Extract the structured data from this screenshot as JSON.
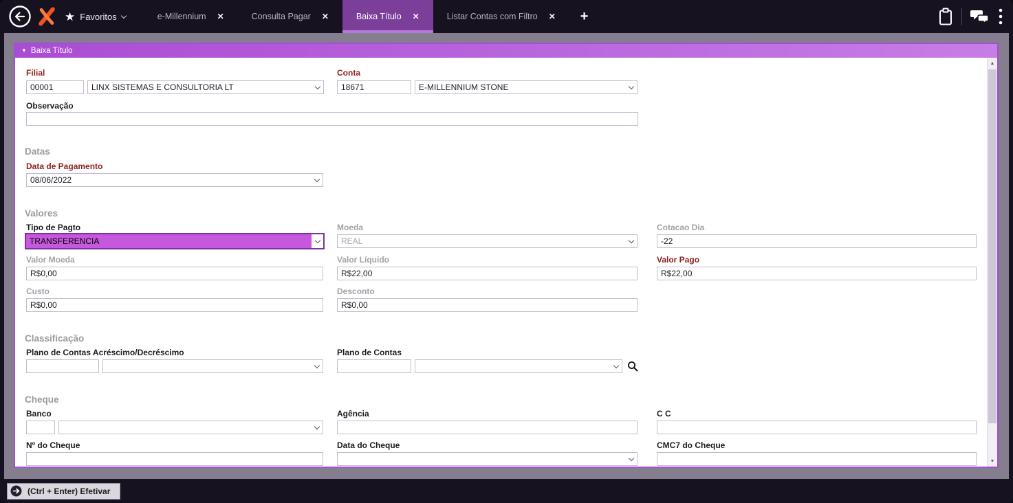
{
  "colors": {
    "topbar_bg": "#171220",
    "workspace_bg": "#847e8f",
    "panel_border": "#a24fd0",
    "panel_header_start": "#aa4cd4",
    "panel_header_end": "#c77de6",
    "active_tab_bg": "#7b3e99",
    "active_tab_underline": "#b678d9",
    "label_red": "#8e2420",
    "label_gray": "#a2a2a2",
    "selected_field_bg": "#c558dd",
    "selected_field_border": "#7e2fa0",
    "logo_orange": "#f4521e"
  },
  "icons": {
    "collapse": "▼",
    "star": "★",
    "close": "✕",
    "plus": "+"
  },
  "topbar": {
    "favorites_label": "Favoritos",
    "tabs": [
      {
        "label": "e-Millennium",
        "active": false
      },
      {
        "label": "Consulta Pagar",
        "active": false
      },
      {
        "label": "Baixa Título",
        "active": true
      },
      {
        "label": "Listar Contas com Filtro",
        "active": false
      }
    ]
  },
  "panel": {
    "header_label": "Baixa Título"
  },
  "form": {
    "filial": {
      "label": "Filial",
      "code": "00001",
      "name": "LINX SISTEMAS E CONSULTORIA LT"
    },
    "conta": {
      "label": "Conta",
      "code": "18671",
      "name": "E-MILLENNIUM STONE"
    },
    "observacao": {
      "label": "Observação",
      "value": ""
    },
    "datas": {
      "section_label": "Datas",
      "data_pagamento": {
        "label": "Data de Pagamento",
        "value": "08/06/2022"
      }
    },
    "valores": {
      "section_label": "Valores",
      "tipo_pagto": {
        "label": "Tipo de Pagto",
        "value": "TRANSFERENCIA"
      },
      "moeda": {
        "label": "Moeda",
        "value": "REAL"
      },
      "cotacao_dia": {
        "label": "Cotacao Dia",
        "value": "-22"
      },
      "valor_moeda": {
        "label": "Valor Moeda",
        "value": "R$0,00"
      },
      "valor_liquido": {
        "label": "Valor Líquido",
        "value": "R$22,00"
      },
      "valor_pago": {
        "label": "Valor Pago",
        "value": "R$22,00"
      },
      "custo": {
        "label": "Custo",
        "value": "R$0,00"
      },
      "desconto": {
        "label": "Desconto",
        "value": "R$0,00"
      }
    },
    "classificacao": {
      "section_label": "Classificação",
      "plano_acrescimo": {
        "label": "Plano de Contas Acréscimo/Decréscimo",
        "code": "",
        "name": ""
      },
      "plano_contas": {
        "label": "Plano de Contas",
        "code": "",
        "name": ""
      }
    },
    "cheque": {
      "section_label": "Cheque",
      "banco": {
        "label": "Banco",
        "code": "",
        "name": ""
      },
      "agencia": {
        "label": "Agência",
        "value": ""
      },
      "cc": {
        "label": "C C",
        "value": ""
      },
      "numero": {
        "label": "Nº do Cheque",
        "value": ""
      },
      "data": {
        "label": "Data do Cheque",
        "value": ""
      },
      "cmc7": {
        "label": "CMC7 do Cheque",
        "value": ""
      }
    }
  },
  "footer": {
    "efetivar_label": "(Ctrl + Enter) Efetivar"
  }
}
